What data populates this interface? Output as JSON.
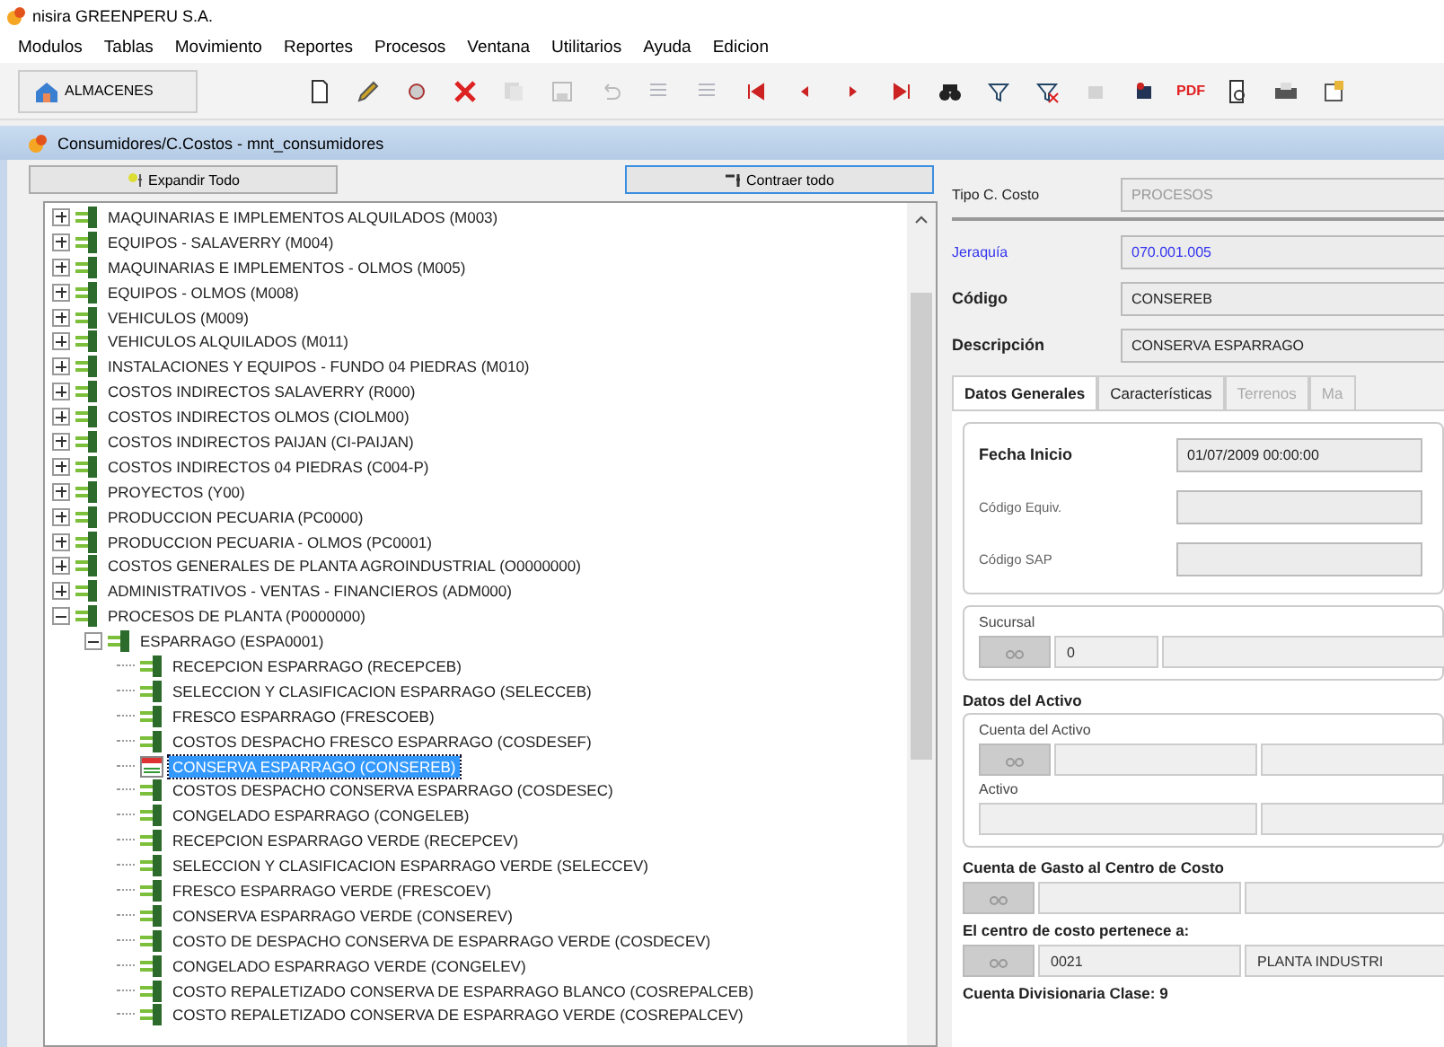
{
  "app_title": "nisira GREENPERU S.A.",
  "menu": [
    "Modulos",
    "Tablas",
    "Movimiento",
    "Reportes",
    "Procesos",
    "Ventana",
    "Utilitarios",
    "Ayuda",
    "Edicion"
  ],
  "module_button": "ALMACENES",
  "toolbar": [
    {
      "kind": "new",
      "disabled": false
    },
    {
      "kind": "edit",
      "disabled": false
    },
    {
      "kind": "view",
      "disabled": false
    },
    {
      "kind": "delete",
      "disabled": false
    },
    {
      "kind": "copy",
      "disabled": true
    },
    {
      "kind": "save",
      "disabled": true
    },
    {
      "kind": "undo",
      "disabled": true
    },
    {
      "kind": "list",
      "disabled": true
    },
    {
      "kind": "list",
      "disabled": true
    },
    {
      "kind": "first",
      "disabled": false
    },
    {
      "kind": "prev",
      "disabled": false
    },
    {
      "kind": "next",
      "disabled": false
    },
    {
      "kind": "last",
      "disabled": false
    },
    {
      "kind": "find",
      "disabled": false
    },
    {
      "kind": "filter",
      "disabled": false
    },
    {
      "kind": "nofilter",
      "disabled": false
    },
    {
      "kind": "import",
      "disabled": true
    },
    {
      "kind": "export",
      "disabled": false
    },
    {
      "kind": "pdf",
      "label": "PDF",
      "disabled": false
    },
    {
      "kind": "preview",
      "disabled": false
    },
    {
      "kind": "print",
      "disabled": false
    },
    {
      "kind": "config",
      "disabled": false
    }
  ],
  "window_title": "Consumidores/C.Costos - mnt_consumidores",
  "expand_button": "Expandir Todo",
  "collapse_button": "Contraer todo",
  "tree": [
    {
      "label": "MAQUINARIAS E IMPLEMENTOS ALQUILADOS (M003)",
      "expanded": false,
      "selected": false
    },
    {
      "label": "EQUIPOS - SALAVERRY (M004)",
      "expanded": false,
      "selected": false
    },
    {
      "label": "MAQUINARIAS E IMPLEMENTOS - OLMOS (M005)",
      "expanded": false,
      "selected": false
    },
    {
      "label": "EQUIPOS - OLMOS (M008)",
      "expanded": false,
      "selected": false
    },
    {
      "label": "VEHICULOS (M009)",
      "expanded": false,
      "selected": false
    },
    {
      "label": "VEHICULOS ALQUILADOS (M011)",
      "expanded": false,
      "selected": false
    },
    {
      "label": "INSTALACIONES Y EQUIPOS - FUNDO 04 PIEDRAS (M010)",
      "expanded": false,
      "selected": false
    },
    {
      "label": "COSTOS INDIRECTOS SALAVERRY (R000)",
      "expanded": false,
      "selected": false
    },
    {
      "label": "COSTOS INDIRECTOS OLMOS (CIOLM00)",
      "expanded": false,
      "selected": false
    },
    {
      "label": "COSTOS INDIRECTOS PAIJAN (CI-PAIJAN)",
      "expanded": false,
      "selected": false
    },
    {
      "label": "COSTOS INDIRECTOS 04 PIEDRAS (C004-P)",
      "expanded": false,
      "selected": false
    },
    {
      "label": "PROYECTOS (Y00)",
      "expanded": false,
      "selected": false
    },
    {
      "label": "PRODUCCION PECUARIA (PC0000)",
      "expanded": false,
      "selected": false
    },
    {
      "label": "PRODUCCION PECUARIA - OLMOS (PC0001)",
      "expanded": false,
      "selected": false
    },
    {
      "label": "COSTOS GENERALES DE PLANTA AGROINDUSTRIAL (O0000000)",
      "expanded": false,
      "selected": false
    },
    {
      "label": "ADMINISTRATIVOS - VENTAS - FINANCIEROS (ADM000)",
      "expanded": false,
      "selected": false
    },
    {
      "label": "PROCESOS DE PLANTA (P0000000)",
      "expanded": true,
      "selected": false,
      "children": [
        {
          "label": "ESPARRAGO (ESPA0001)",
          "expanded": true,
          "selected": false,
          "children": [
            {
              "label": "RECEPCION ESPARRAGO (RECEPCEB)",
              "selected": false
            },
            {
              "label": "SELECCION Y CLASIFICACION ESPARRAGO (SELECCEB)",
              "selected": false
            },
            {
              "label": "FRESCO ESPARRAGO (FRESCOEB)",
              "selected": false
            },
            {
              "label": "COSTOS DESPACHO FRESCO ESPARRAGO (COSDESEF)",
              "selected": false
            },
            {
              "label": "CONSERVA ESPARRAGO (CONSEREB)",
              "selected": true
            },
            {
              "label": "COSTOS DESPACHO CONSERVA ESPARRAGO (COSDESEC)",
              "selected": false
            },
            {
              "label": "CONGELADO ESPARRAGO (CONGELEB)",
              "selected": false
            },
            {
              "label": "RECEPCION ESPARRAGO VERDE (RECEPCEV)",
              "selected": false
            },
            {
              "label": "SELECCION Y CLASIFICACION ESPARRAGO VERDE (SELECCEV)",
              "selected": false
            },
            {
              "label": "FRESCO ESPARRAGO VERDE (FRESCOEV)",
              "selected": false
            },
            {
              "label": "CONSERVA ESPARRAGO VERDE (CONSEREV)",
              "selected": false
            },
            {
              "label": "COSTO DE DESPACHO CONSERVA DE ESPARRAGO VERDE (COSDECEV)",
              "selected": false
            },
            {
              "label": "CONGELADO ESPARRAGO VERDE (CONGELEV)",
              "selected": false
            },
            {
              "label": "COSTO REPALETIZADO CONSERVA DE ESPARRAGO BLANCO (COSREPALCEB)",
              "selected": false
            },
            {
              "label": "COSTO REPALETIZADO CONSERVA DE ESPARRAGO VERDE (COSREPALCEV)",
              "selected": false
            }
          ]
        }
      ]
    }
  ],
  "header_fields": [
    {
      "kind": "select",
      "label": "Tipo C. Costo",
      "value": "PROCESOS",
      "disabled": true
    },
    {
      "kind": "link",
      "label": "Jeraquía",
      "value": "070.001.005"
    },
    {
      "kind": "text",
      "label": "Código",
      "value": "CONSEREB"
    },
    {
      "kind": "text",
      "label": "Descripción",
      "value": "CONSERVA ESPARRAGO"
    }
  ],
  "tabs": [
    {
      "label": "Datos Generales",
      "selected": true,
      "disabled": false
    },
    {
      "label": "Características",
      "selected": false,
      "disabled": false
    },
    {
      "label": "Terrenos",
      "selected": false,
      "disabled": true
    },
    {
      "label": "Ma",
      "selected": false,
      "disabled": true
    }
  ],
  "general_fields": [
    {
      "label": "Fecha Inicio",
      "value": "01/07/2009 00:00:00",
      "bold": true
    },
    {
      "label": "Código Equiv.",
      "bold": false
    },
    {
      "label": "Código SAP",
      "bold": false
    }
  ],
  "sucursal": {
    "label": "Sucursal",
    "code": "0"
  },
  "activo_group": {
    "title": "Datos del Activo",
    "cuenta_label": "Cuenta del Activo",
    "activo_label": "Activo"
  },
  "gasto": {
    "title": "Cuenta de Gasto  al Centro de Costo"
  },
  "pertenece": {
    "title": "El centro de costo pertenece a:",
    "code": "0021",
    "name": "PLANTA INDUSTRI"
  },
  "divisionaria": {
    "title": "Cuenta Divisionaria Clase: 9"
  }
}
